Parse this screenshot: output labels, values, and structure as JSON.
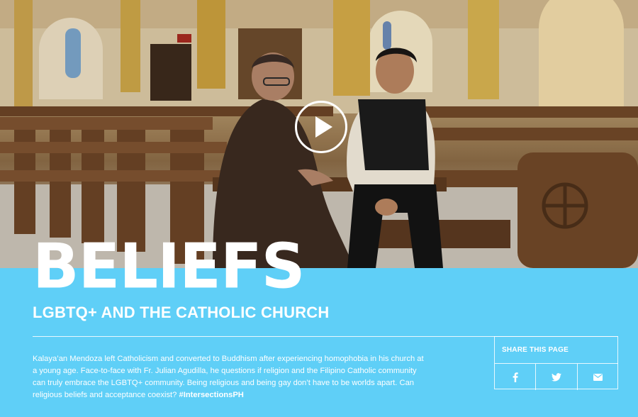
{
  "hero": {
    "play_icon": "play-icon"
  },
  "article": {
    "title": "BELIEFS",
    "subtitle": "LGBTQ+ AND THE CATHOLIC CHURCH",
    "description": "Kalaya’an Mendoza left Catholicism and converted to Buddhism after experiencing homophobia in his church at a young age. Face-to-face with Fr. Julian Agudilla, he questions if religion and the Filipino Catholic community can truly embrace the LGBTQ+ community. Being religious and being gay don’t have to be worlds apart. Can religious beliefs and acceptance coexist?",
    "hashtag": "#IntersectionsPH"
  },
  "share": {
    "label": "SHARE THIS PAGE",
    "buttons": [
      {
        "icon": "facebook-icon",
        "glyph": "f"
      },
      {
        "icon": "twitter-icon",
        "glyph": "t"
      },
      {
        "icon": "envelope-icon",
        "glyph": "e"
      }
    ]
  },
  "colors": {
    "panel_bg": "#5fcff7",
    "text": "#ffffff"
  }
}
